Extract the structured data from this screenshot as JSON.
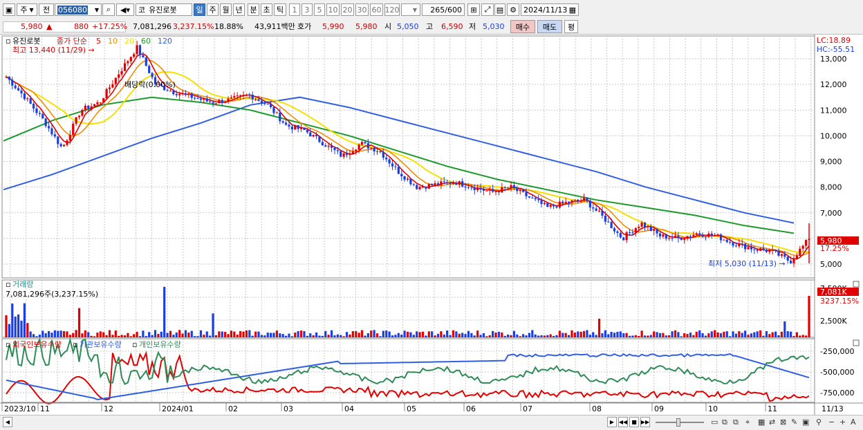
{
  "toolbar": {
    "market": "주",
    "type_btn": "전",
    "code": "056080",
    "name": "유진로봇",
    "name_prefix": "코",
    "periods": [
      "일",
      "주",
      "월",
      "년",
      "분",
      "초",
      "틱"
    ],
    "active_period": "일",
    "intervals": [
      "1",
      "3",
      "5",
      "10",
      "20",
      "30",
      "60",
      "120"
    ],
    "count": "265",
    "count_max": "/600",
    "date": "2024/11/13"
  },
  "info": {
    "price": "5,980",
    "arrow": "▲",
    "change": "880",
    "rate": "+17.25%",
    "volume": "7,081,296",
    "vol_rate": "3,237.15%",
    "turnover": "18.88%",
    "amount": "43,911백만",
    "quote_label": "호가",
    "ask": "5,990",
    "bid": "5,980",
    "open_label": "시",
    "open": "5,050",
    "high_label": "고",
    "high": "6,590",
    "low_label": "저",
    "low": "5,030",
    "buy_btn": "매수",
    "sell_btn": "매도",
    "eval_btn": "평"
  },
  "price_panel": {
    "title": "유진로봇",
    "ma_label": "종가 단순",
    "ma_periods": [
      "5",
      "10",
      "20",
      "60",
      "120"
    ],
    "high_annot": "최고 13,440 (11/29)",
    "low_annot": "최저 5,030 (11/13)",
    "event_annot": "배당락(0.00%)",
    "lc": "LC:18.89",
    "hc": "HC:-55.51",
    "yticks": [
      "13,000",
      "12,000",
      "11,000",
      "10,000",
      "9,000",
      "8,000",
      "7,000",
      "5,000"
    ],
    "cur_price": "5,980",
    "cur_rate": "17.25%"
  },
  "volume_panel": {
    "title": "거래량",
    "desc": "7,081,296주(3,237.15%)",
    "yticks": [
      "7,500K",
      "2,500K"
    ],
    "cur": "7,081K",
    "cur_rate": "3237.15%"
  },
  "holding_panel": {
    "legend": [
      "외국인보유수량",
      "기관보유수량",
      "개인보유수량"
    ],
    "yticks": [
      "-250,000",
      "-500,000",
      "-750,000"
    ]
  },
  "xaxis": {
    "labels": [
      "2023/10",
      "11",
      "12",
      "2024/01",
      "02",
      "03",
      "04",
      "05",
      "06",
      "07",
      "08",
      "09",
      "10",
      "11"
    ],
    "right_label": "11/13"
  },
  "colors": {
    "ma5": "#e00000",
    "ma10": "#f08c00",
    "ma20": "#f5e000",
    "ma60": "#1a9a2a",
    "ma120": "#2f5ee0",
    "up": "#e00000",
    "down": "#1a3ee0",
    "foreign": "#e00000",
    "inst": "#2f5ee0",
    "indiv": "#2e8b57"
  },
  "chart_data": {
    "type": "candlestick",
    "price_range": [
      5000,
      13500
    ],
    "price_series": [
      {
        "date": "2023/10",
        "close": 12300
      },
      {
        "date": "2023/10",
        "close": 11500
      },
      {
        "date": "2023/10",
        "close": 10600
      },
      {
        "date": "2023/11",
        "close": 9500
      },
      {
        "date": "2023/11",
        "close": 11000
      },
      {
        "date": "2023/11",
        "close": 11300
      },
      {
        "date": "2023/11",
        "close": 12400
      },
      {
        "date": "2023/11",
        "close": 13440
      },
      {
        "date": "2023/12",
        "close": 12000
      },
      {
        "date": "2023/12",
        "close": 11700
      },
      {
        "date": "2023/12",
        "close": 11500
      },
      {
        "date": "2024/01",
        "close": 11300
      },
      {
        "date": "2024/01",
        "close": 11400
      },
      {
        "date": "2024/01",
        "close": 11600
      },
      {
        "date": "2024/02",
        "close": 11200
      },
      {
        "date": "2024/02",
        "close": 10400
      },
      {
        "date": "2024/02",
        "close": 10200
      },
      {
        "date": "2024/03",
        "close": 9700
      },
      {
        "date": "2024/03",
        "close": 9200
      },
      {
        "date": "2024/03",
        "close": 9700
      },
      {
        "date": "2024/04",
        "close": 9400
      },
      {
        "date": "2024/04",
        "close": 8600
      },
      {
        "date": "2024/04",
        "close": 8000
      },
      {
        "date": "2024/05",
        "close": 8100
      },
      {
        "date": "2024/05",
        "close": 8200
      },
      {
        "date": "2024/05",
        "close": 8000
      },
      {
        "date": "2024/06",
        "close": 7800
      },
      {
        "date": "2024/06",
        "close": 8000
      },
      {
        "date": "2024/06",
        "close": 7600
      },
      {
        "date": "2024/07",
        "close": 7200
      },
      {
        "date": "2024/07",
        "close": 7400
      },
      {
        "date": "2024/07",
        "close": 7500
      },
      {
        "date": "2024/08",
        "close": 6800
      },
      {
        "date": "2024/08",
        "close": 6000
      },
      {
        "date": "2024/08",
        "close": 6600
      },
      {
        "date": "2024/09",
        "close": 6100
      },
      {
        "date": "2024/09",
        "close": 6000
      },
      {
        "date": "2024/09",
        "close": 6200
      },
      {
        "date": "2024/10",
        "close": 6100
      },
      {
        "date": "2024/10",
        "close": 5800
      },
      {
        "date": "2024/10",
        "close": 5600
      },
      {
        "date": "2024/11",
        "close": 5500
      },
      {
        "date": "2024/11",
        "close": 5100
      },
      {
        "date": "2024/11",
        "close": 5980
      }
    ],
    "ma60": [
      9800,
      10600,
      11200,
      11500,
      11300,
      11000,
      10500,
      10000,
      9400,
      8800,
      8300,
      7900,
      7500,
      7200,
      6900,
      6500,
      6200
    ],
    "ma120": [
      7900,
      8500,
      9200,
      9900,
      10500,
      11200,
      11500,
      11100,
      10600,
      10100,
      9600,
      9100,
      8600,
      8000,
      7500,
      7000,
      6600
    ]
  }
}
